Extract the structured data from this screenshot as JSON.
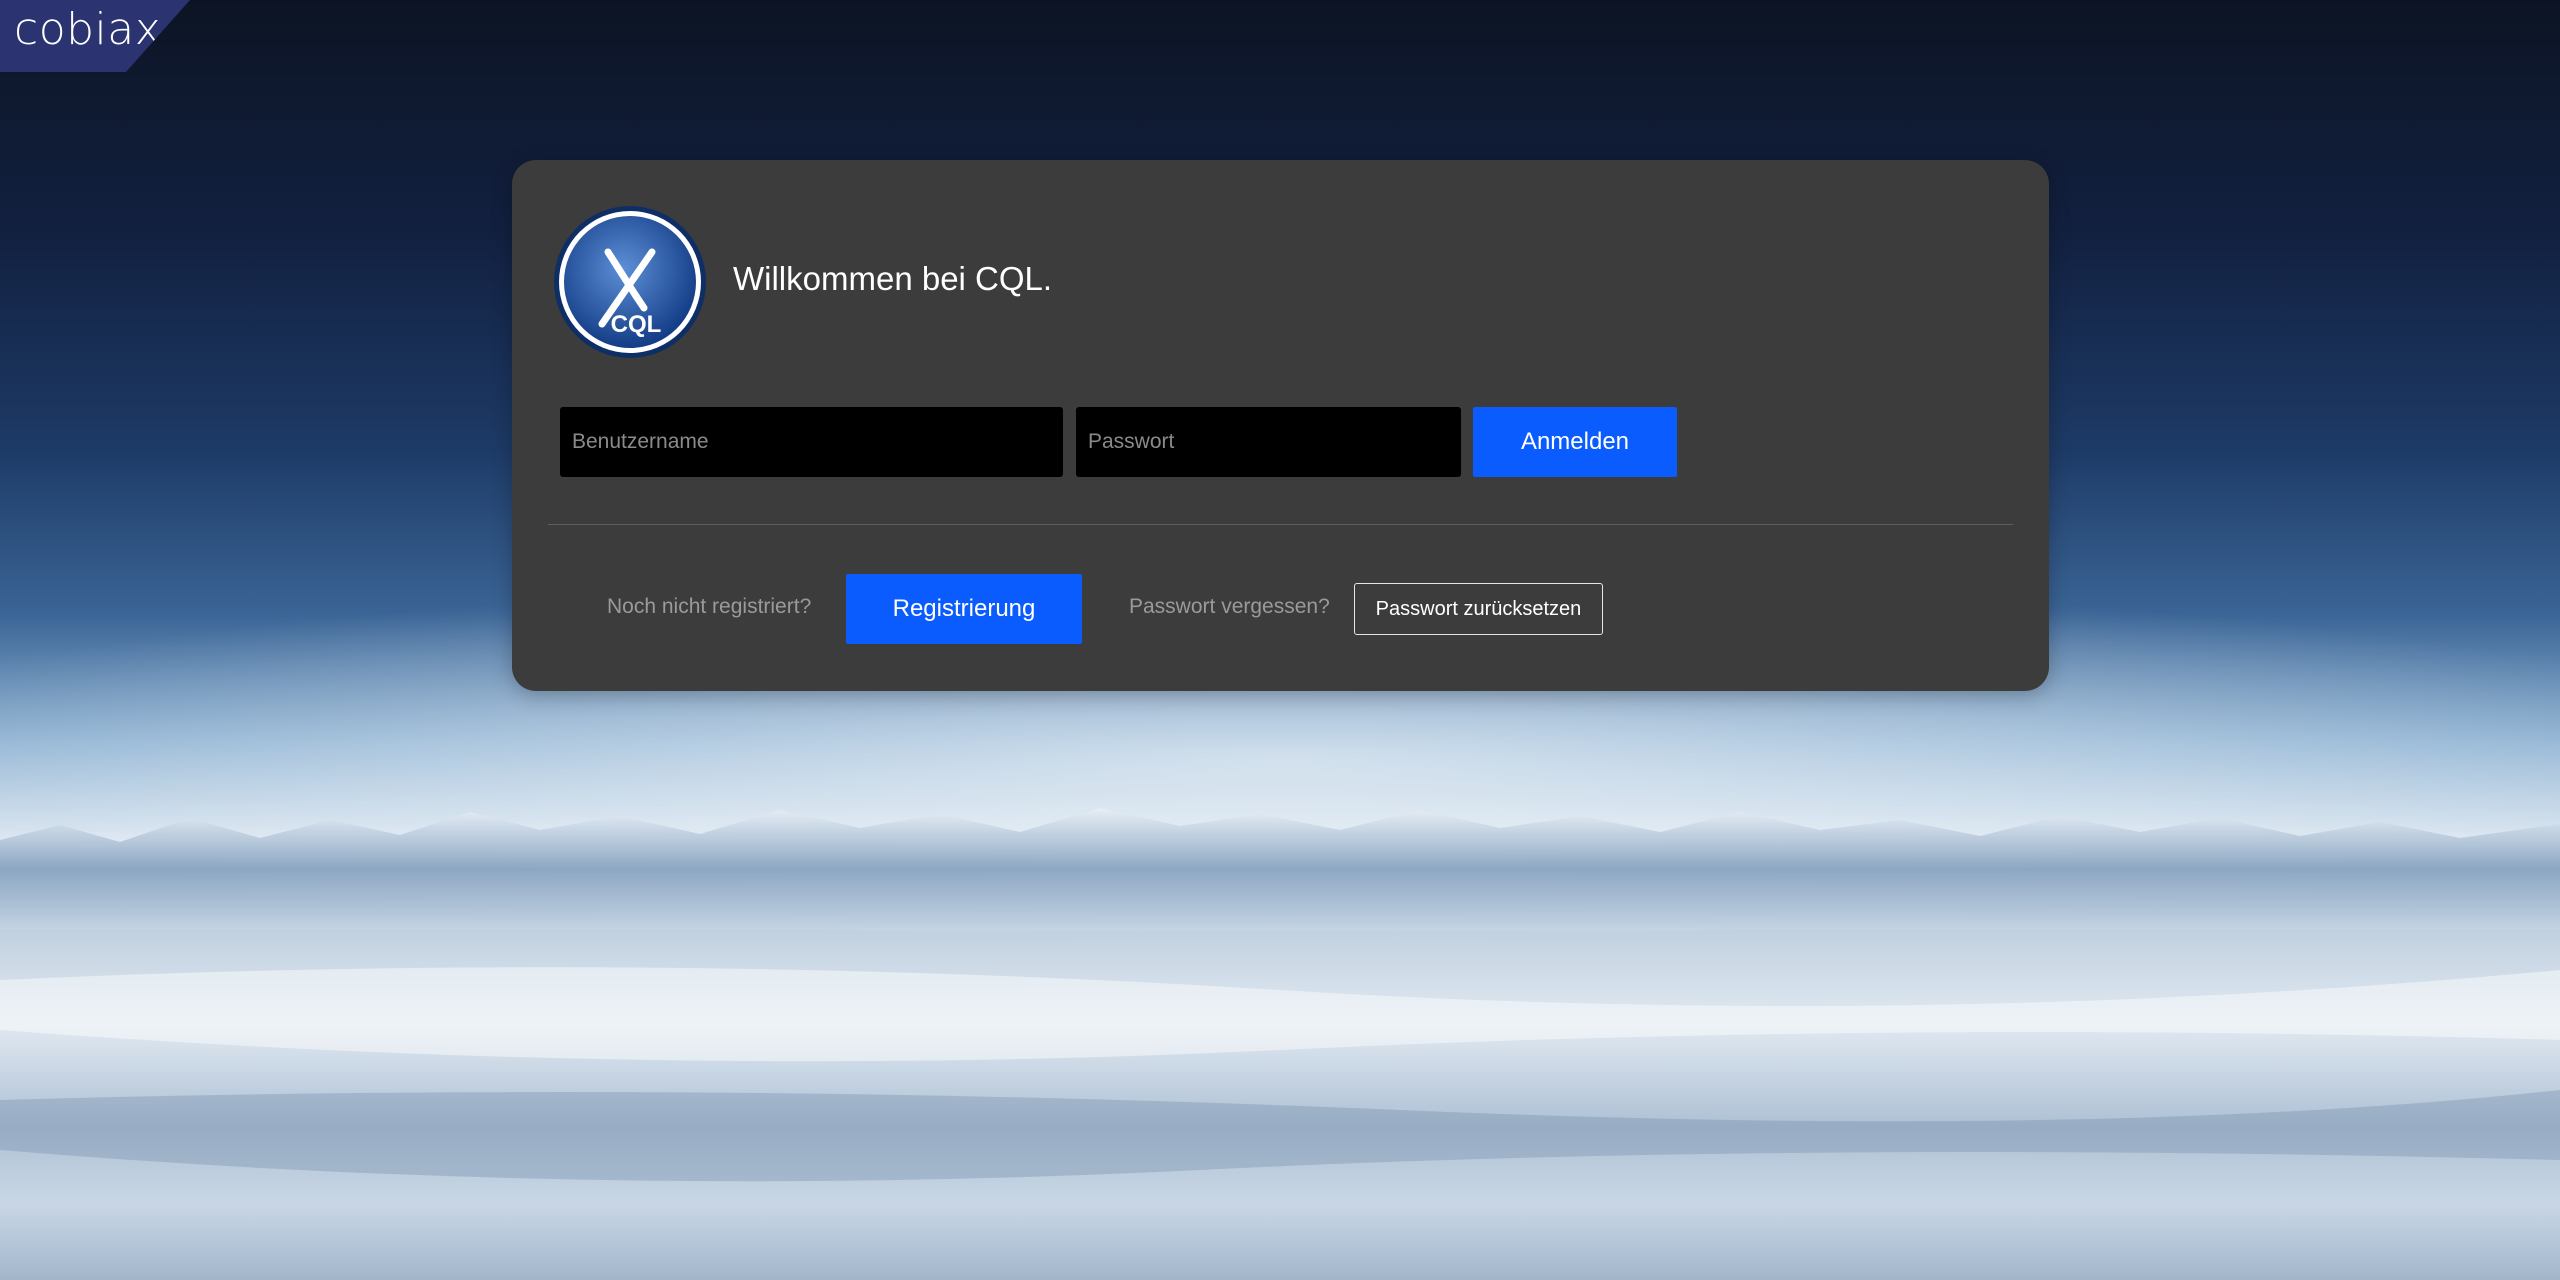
{
  "brand": {
    "logo_text": "cobiax"
  },
  "card": {
    "logo_text": "CQL",
    "welcome": "Willkommen bei CQL."
  },
  "login": {
    "username_placeholder": "Benutzername",
    "password_placeholder": "Passwort",
    "submit_label": "Anmelden"
  },
  "register": {
    "prompt": "Noch nicht registriert?",
    "button_label": "Registrierung"
  },
  "forgot": {
    "prompt": "Passwort vergessen?",
    "button_label": "Passwort zurücksetzen"
  },
  "colors": {
    "card_bg": "#3c3c3c",
    "primary": "#0a5cff",
    "brand_bg": "#2b3370"
  }
}
